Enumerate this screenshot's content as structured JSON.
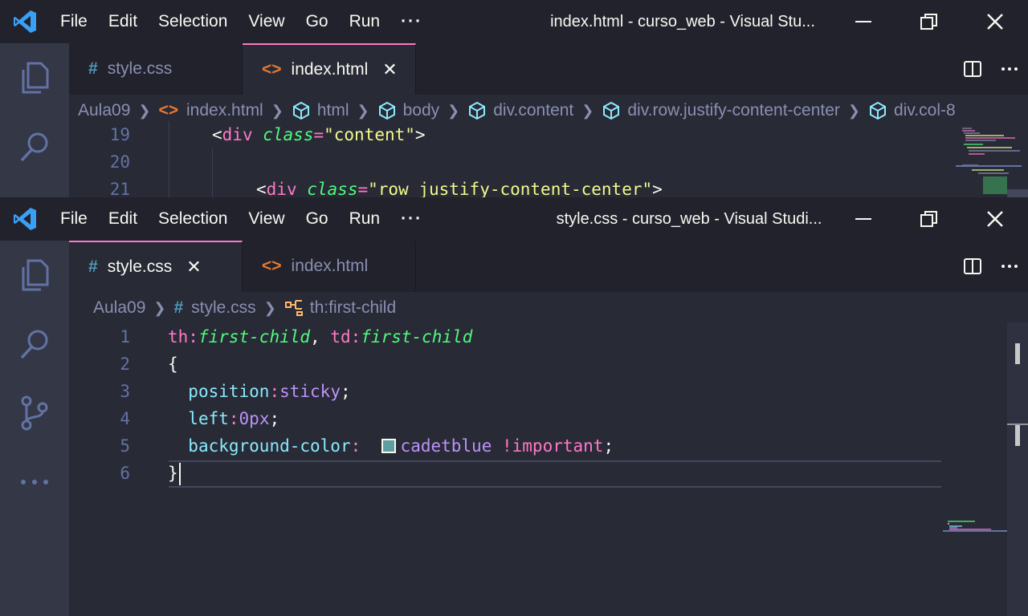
{
  "top_window": {
    "menu": [
      "File",
      "Edit",
      "Selection",
      "View",
      "Go",
      "Run",
      "···"
    ],
    "title": "index.html - curso_web - Visual Stu...",
    "tabs": [
      {
        "icon": "#",
        "label": "style.css",
        "active": false
      },
      {
        "icon": "<>",
        "label": "index.html",
        "active": true,
        "close": "✕"
      }
    ],
    "breadcrumbs": [
      "Aula09",
      "index.html",
      "html",
      "body",
      "div.content",
      "div.row.justify-content-center",
      "div.col-8"
    ],
    "code": [
      {
        "ln": "19",
        "tokens": [
          [
            "fg",
            "<"
          ],
          [
            "pk",
            "div"
          ],
          [
            "fg",
            " "
          ],
          [
            "gr",
            "class"
          ],
          [
            "pk",
            "="
          ],
          [
            "ye",
            "\"content\""
          ],
          [
            "fg",
            ">"
          ]
        ],
        "indent": 2
      },
      {
        "ln": "20",
        "tokens": [],
        "indent": 0
      },
      {
        "ln": "21",
        "tokens": [
          [
            "fg",
            "<"
          ],
          [
            "pk",
            "div"
          ],
          [
            "fg",
            " "
          ],
          [
            "gr",
            "class"
          ],
          [
            "pk",
            "="
          ],
          [
            "ye",
            "\"row justify-content-center\""
          ],
          [
            "fg",
            ">"
          ]
        ],
        "indent": 3
      }
    ]
  },
  "bottom_window": {
    "menu": [
      "File",
      "Edit",
      "Selection",
      "View",
      "Go",
      "Run",
      "···"
    ],
    "title": "style.css - curso_web - Visual Studi...",
    "tabs": [
      {
        "icon": "#",
        "label": "style.css",
        "active": true,
        "close": "✕"
      },
      {
        "icon": "<>",
        "label": "index.html",
        "active": false
      }
    ],
    "breadcrumbs": [
      "Aula09",
      "style.css",
      "th:first-child"
    ],
    "code": [
      {
        "ln": "1",
        "tokens": [
          [
            "pk",
            "th"
          ],
          [
            "pk",
            ":"
          ],
          [
            "gr",
            "first-child"
          ],
          [
            "fg",
            ", "
          ],
          [
            "pk",
            "td"
          ],
          [
            "pk",
            ":"
          ],
          [
            "gr",
            "first-child"
          ]
        ]
      },
      {
        "ln": "2",
        "tokens": [
          [
            "fg",
            "{"
          ]
        ]
      },
      {
        "ln": "3",
        "tokens": [
          [
            "fg",
            "  "
          ],
          [
            "cy",
            "position"
          ],
          [
            "pk",
            ":"
          ],
          [
            "pu",
            "sticky"
          ],
          [
            "fg",
            ";"
          ]
        ]
      },
      {
        "ln": "4",
        "tokens": [
          [
            "fg",
            "  "
          ],
          [
            "cy",
            "left"
          ],
          [
            "pk",
            ":"
          ],
          [
            "pu",
            "0px"
          ],
          [
            "fg",
            ";"
          ]
        ]
      },
      {
        "ln": "5",
        "tokens": [
          [
            "fg",
            "  "
          ],
          [
            "cy",
            "background-color"
          ],
          [
            "pk",
            ":"
          ],
          [
            "fg",
            "  "
          ],
          [
            "swatch",
            "#5f9ea0"
          ],
          [
            "pu",
            "cadetblue"
          ],
          [
            "fg",
            " "
          ],
          [
            "pk",
            "!important"
          ],
          [
            "fg",
            ";"
          ]
        ]
      },
      {
        "ln": "6",
        "tokens": [
          [
            "fg",
            "}"
          ]
        ]
      }
    ]
  },
  "colors": {
    "accent": "#ff79c6",
    "editor_bg": "#282a36",
    "titlebar_bg": "#21222c",
    "activity_bg": "#343746",
    "vscode_blue": "#3aa0f3",
    "cadetblue": "#5f9ea0"
  }
}
